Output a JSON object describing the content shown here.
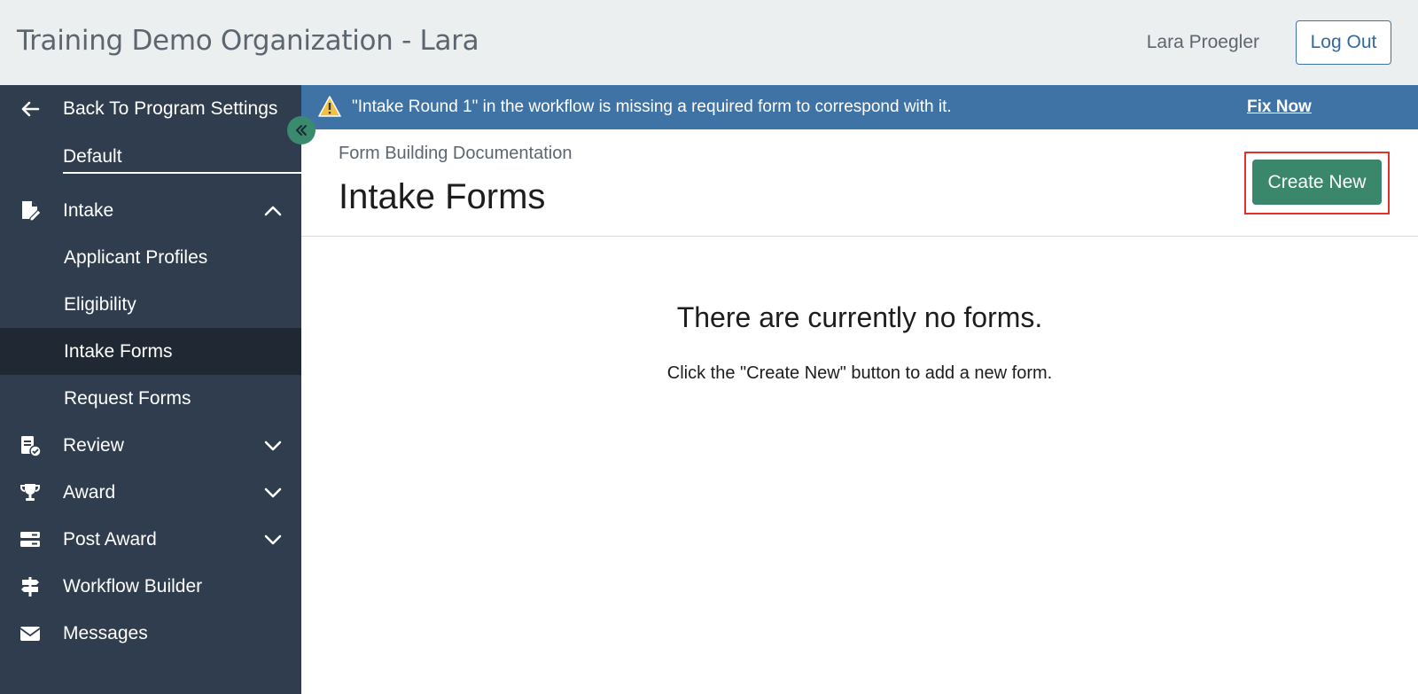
{
  "header": {
    "org_title": "Training Demo Organization - Lara",
    "user_name": "Lara Proegler",
    "logout_label": "Log Out"
  },
  "sidebar": {
    "back_label": "Back To Program Settings",
    "default_label": "Default",
    "items": [
      {
        "label": "Intake",
        "icon": "file-edit-icon",
        "expanded": true
      },
      {
        "label": "Applicant Profiles"
      },
      {
        "label": "Eligibility"
      },
      {
        "label": "Intake Forms",
        "active": true
      },
      {
        "label": "Request Forms"
      },
      {
        "label": "Review",
        "icon": "file-check-icon",
        "expanded": false
      },
      {
        "label": "Award",
        "icon": "trophy-icon",
        "expanded": false
      },
      {
        "label": "Post Award",
        "icon": "server-icon",
        "expanded": false
      },
      {
        "label": "Workflow Builder",
        "icon": "signpost-icon"
      },
      {
        "label": "Messages",
        "icon": "envelope-icon"
      }
    ]
  },
  "banner": {
    "message": "\"Intake Round 1\" in the workflow is missing a required form to correspond with it.",
    "fix_label": "Fix Now"
  },
  "main": {
    "breadcrumb": "Form Building Documentation",
    "title": "Intake Forms",
    "create_label": "Create New",
    "empty_title": "There are currently no forms.",
    "empty_sub": "Click the \"Create New\" button to add a new form."
  },
  "colors": {
    "sidebar_bg": "#2f3d4e",
    "sidebar_active": "#1f2833",
    "banner_bg": "#3f73a6",
    "primary_green": "#3a876b",
    "highlight_red": "#e2302a"
  }
}
